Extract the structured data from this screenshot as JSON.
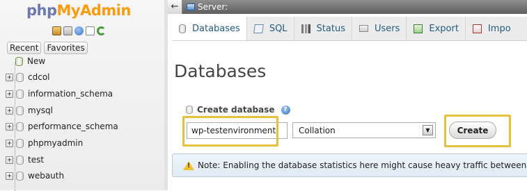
{
  "logo": {
    "php": "php",
    "my": "My",
    "admin": "Admin"
  },
  "nav": {
    "icons": [
      "home-icon",
      "logout-icon",
      "help-icon",
      "docs-icon",
      "reload-icon"
    ],
    "recent_label": "Recent",
    "favorites_label": "Favorites",
    "new_label": "New",
    "databases": [
      "cdcol",
      "information_schema",
      "mysql",
      "performance_schema",
      "phpmyadmin",
      "test",
      "webauth"
    ]
  },
  "server_bar": {
    "back_label": "←",
    "label": "Server:"
  },
  "tabs": [
    {
      "label": "Databases",
      "icon": "database-icon",
      "active": true
    },
    {
      "label": "SQL",
      "icon": "sql-icon",
      "active": false
    },
    {
      "label": "Status",
      "icon": "status-icon",
      "active": false
    },
    {
      "label": "Users",
      "icon": "users-icon",
      "active": false
    },
    {
      "label": "Export",
      "icon": "export-icon",
      "active": false
    },
    {
      "label": "Impo",
      "icon": "import-icon",
      "active": false
    }
  ],
  "main": {
    "heading": "Databases",
    "create_label": "Create database",
    "help_glyph": "?",
    "db_name_value": "wp-testenvironment",
    "collation_value": "Collation",
    "collation_arrow": "▼",
    "create_button": "Create",
    "notice": "Note: Enabling the database statistics here might cause heavy traffic between the"
  },
  "colors": {
    "highlight": "#e6bf3b",
    "link": "#235a81",
    "logo_orange": "#f89c0e",
    "logo_blue": "#6c78af"
  }
}
